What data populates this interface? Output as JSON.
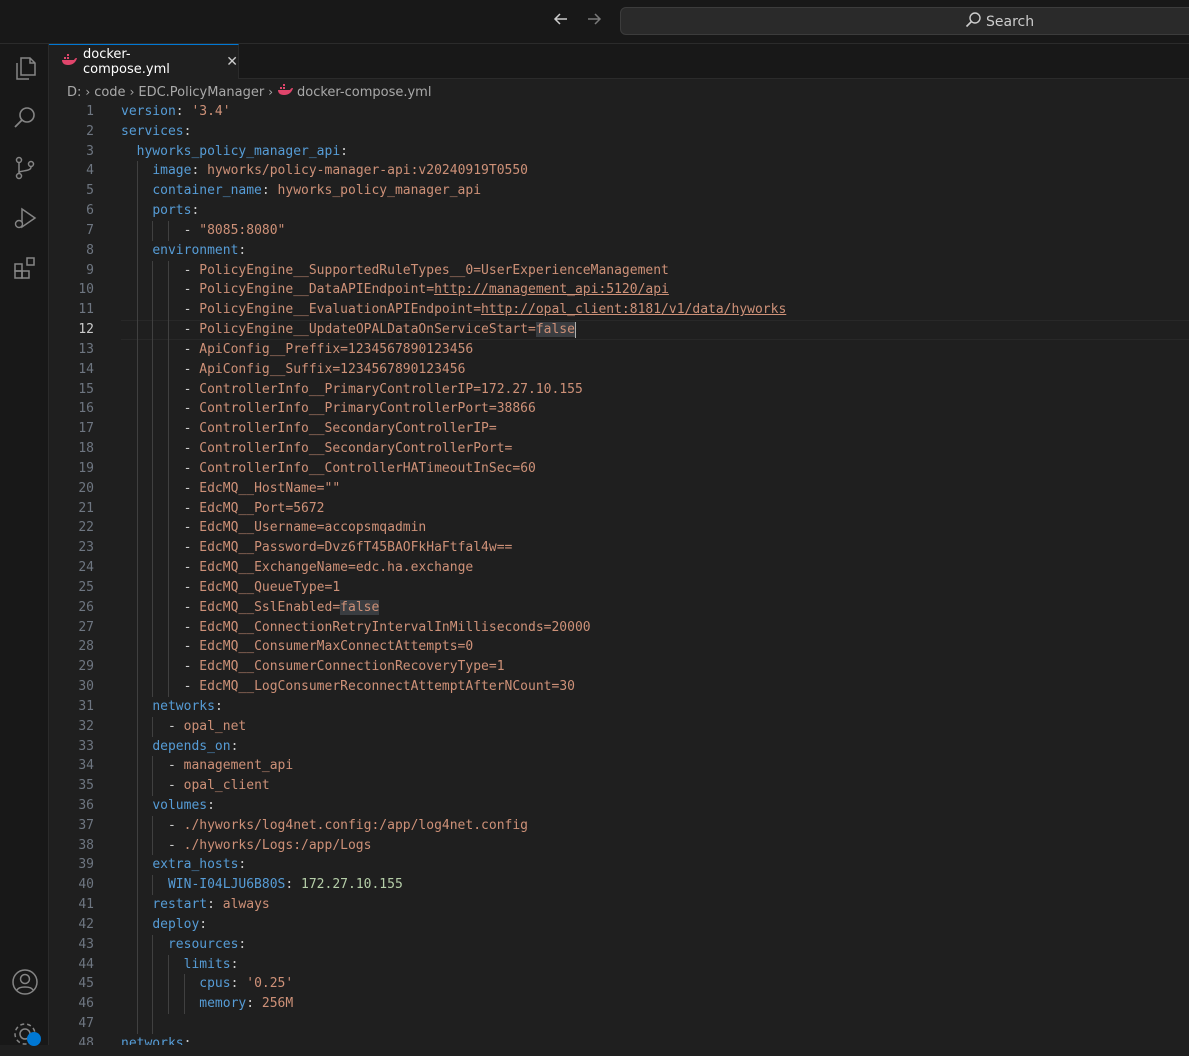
{
  "titlebar": {
    "search_label": "Search"
  },
  "tab": {
    "label": "docker-compose.yml",
    "close": "✕"
  },
  "breadcrumb": [
    "D:",
    "code",
    "EDC.PolicyManager",
    "docker-compose.yml"
  ],
  "editor": {
    "current_line": 12,
    "lines": [
      "version: '3.4'",
      "services:",
      "  hyworks_policy_manager_api:",
      "    image: hyworks/policy-manager-api:v20240919T0550",
      "    container_name: hyworks_policy_manager_api",
      "    ports:",
      "        - \"8085:8080\"",
      "    environment:",
      "        - PolicyEngine__SupportedRuleTypes__0=UserExperienceManagement",
      "        - PolicyEngine__DataAPIEndpoint=http://management_api:5120/api",
      "        - PolicyEngine__EvaluationAPIEndpoint=http://opal_client:8181/v1/data/hyworks",
      "        - PolicyEngine__UpdateOPALDataOnServiceStart=false",
      "        - ApiConfig__Preffix=1234567890123456",
      "        - ApiConfig__Suffix=1234567890123456",
      "        - ControllerInfo__PrimaryControllerIP=172.27.10.155",
      "        - ControllerInfo__PrimaryControllerPort=38866",
      "        - ControllerInfo__SecondaryControllerIP=",
      "        - ControllerInfo__SecondaryControllerPort=",
      "        - ControllerInfo__ControllerHATimeoutInSec=60",
      "        - EdcMQ__HostName=\"\"",
      "        - EdcMQ__Port=5672",
      "        - EdcMQ__Username=accopsmqadmin",
      "        - EdcMQ__Password=Dvz6fT45BAOFkHaFtfal4w==",
      "        - EdcMQ__ExchangeName=edc.ha.exchange",
      "        - EdcMQ__QueueType=1",
      "        - EdcMQ__SslEnabled=false",
      "        - EdcMQ__ConnectionRetryIntervalInMilliseconds=20000",
      "        - EdcMQ__ConsumerMaxConnectAttempts=0",
      "        - EdcMQ__ConsumerConnectionRecoveryType=1",
      "        - EdcMQ__LogConsumerReconnectAttemptAfterNCount=30",
      "    networks:",
      "      - opal_net",
      "    depends_on:",
      "      - management_api",
      "      - opal_client",
      "    volumes:",
      "      - ./hyworks/log4net.config:/app/log4net.config",
      "      - ./hyworks/Logs:/app/Logs",
      "    extra_hosts:",
      "      WIN-I04LJU6B80S: 172.27.10.155",
      "    restart: always",
      "    deploy:",
      "      resources:",
      "        limits:",
      "          cpus: '0.25'",
      "          memory: 256M",
      "",
      "networks:"
    ]
  },
  "icons": [
    "explorer-icon",
    "search-icon",
    "source-control-icon",
    "run-debug-icon",
    "extensions-icon",
    "account-icon",
    "settings-gear-icon"
  ]
}
